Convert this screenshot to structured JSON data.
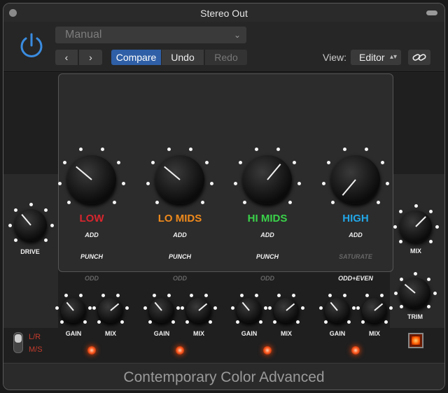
{
  "window": {
    "title": "Stereo Out"
  },
  "toolbar": {
    "preset": "Manual",
    "prev": "‹",
    "next": "›",
    "compare": "Compare",
    "undo": "Undo",
    "redo": "Redo",
    "view_label": "View:",
    "view_value": "Editor",
    "colors": {
      "accent": "#2f5fa6",
      "power": "#3a8ce0"
    }
  },
  "plugin": {
    "name": "Contemporary Color Advanced",
    "drive_label": "DRIVE",
    "mix_label": "MIX",
    "trim_label": "TRIM",
    "mode_lr": "L/R",
    "mode_ms": "M/S",
    "bands": [
      {
        "label": "LOW",
        "color": "#d9262e",
        "opts": [
          "ADD",
          "PUNCH",
          "ODD"
        ],
        "opts_on": [
          true,
          true,
          false
        ],
        "gain": "GAIN",
        "mix": "MIX"
      },
      {
        "label": "LO MIDS",
        "color": "#f08a1c",
        "opts": [
          "ADD",
          "PUNCH",
          "ODD"
        ],
        "opts_on": [
          true,
          true,
          false
        ],
        "gain": "GAIN",
        "mix": "MIX"
      },
      {
        "label": "HI MIDS",
        "color": "#3ad24a",
        "opts": [
          "ADD",
          "PUNCH",
          "ODD"
        ],
        "opts_on": [
          true,
          true,
          false
        ],
        "gain": "GAIN",
        "mix": "MIX"
      },
      {
        "label": "HIGH",
        "color": "#22a6e6",
        "opts": [
          "ADD",
          "SATURATE",
          "ODD+EVEN"
        ],
        "opts_on": [
          true,
          false,
          true
        ],
        "gain": "GAIN",
        "mix": "MIX"
      }
    ]
  }
}
